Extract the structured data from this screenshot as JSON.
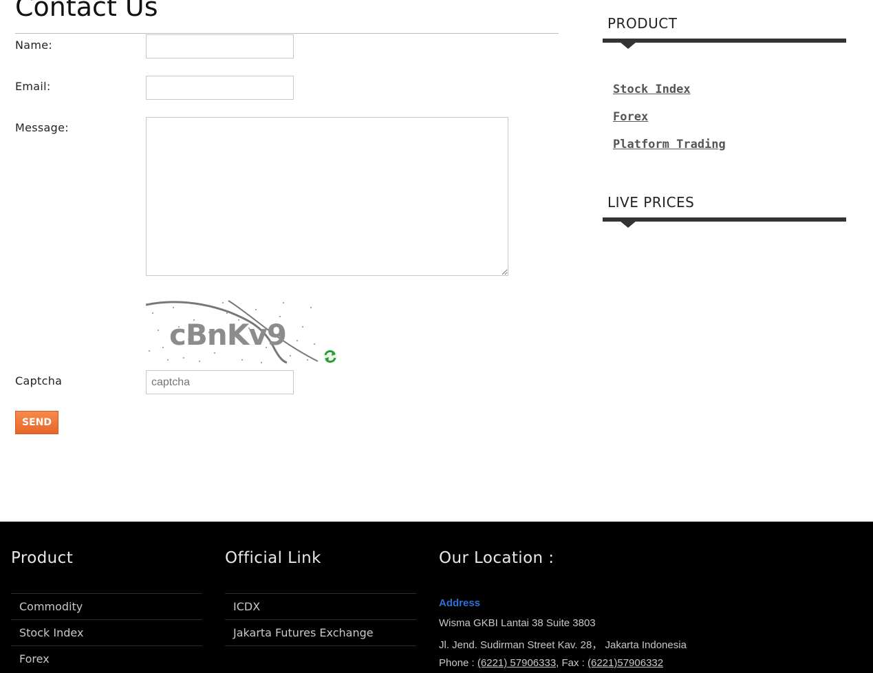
{
  "page": {
    "title": "Contact Us"
  },
  "form": {
    "name_label": "Name:",
    "email_label": "Email:",
    "message_label": "Message:",
    "captcha_label": "Captcha",
    "name_value": "",
    "email_value": "",
    "message_value": "",
    "captcha_placeholder": "captcha",
    "captcha_image_text": "cBnKv9",
    "send_label": "SEND"
  },
  "sidebar": {
    "product_heading": "PRODUCT",
    "product_links": [
      "Stock Index",
      "Forex",
      "Platform Trading"
    ],
    "live_prices_heading": "LIVE PRICES"
  },
  "footer": {
    "product_heading": "Product",
    "product_items": [
      "Commodity",
      "Stock Index",
      "Forex"
    ],
    "official_heading": "Official Link",
    "official_items": [
      "ICDX",
      "Jakarta Futures Exchange"
    ],
    "location_heading": "Our Location :",
    "address_heading": "Address",
    "address_line1": "Wisma GKBI Lantai 38 Suite 3803",
    "address_line2": "Jl. Jend. Sudirman Street Kav. 28， Jakarta Indonesia",
    "phone_prefix": "Phone : ",
    "phone": "(6221) 57906333",
    "fax_prefix": ", Fax : ",
    "fax": "(6221)57906332"
  },
  "colors": {
    "send_button": "#e8662a",
    "footer_bg": "#000000",
    "address_heading": "#2f6fdb",
    "sidebar_bar": "#333333"
  },
  "icons": {
    "refresh": "refresh-icon"
  }
}
